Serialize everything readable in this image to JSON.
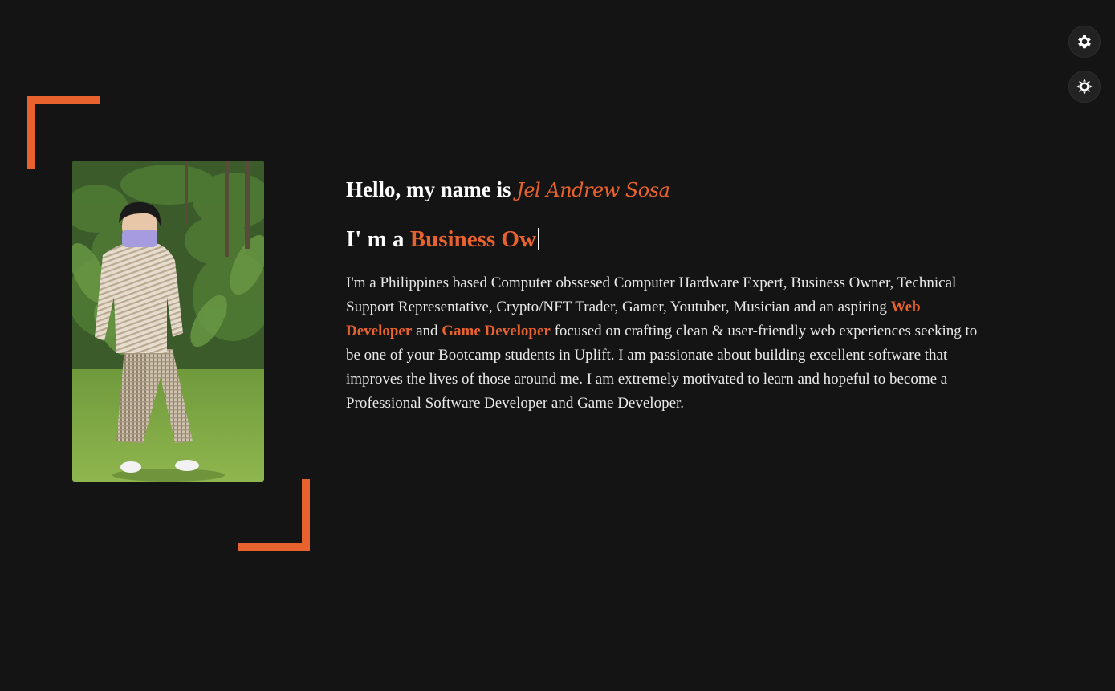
{
  "colors": {
    "background": "#141414",
    "accent": "#e8622d",
    "text": "#ffffff"
  },
  "controls": {
    "settings_icon": "gear-icon",
    "theme_icon": "sun-icon"
  },
  "profile": {
    "photo_icon": "profile-photo"
  },
  "intro": {
    "greeting_prefix": "Hello, my name is ",
    "name": "Jel Andrew Sosa",
    "role_prefix": "I' m a ",
    "role_typed": "Business Ow",
    "bio_part1": "I'm a Philippines based Computer obssesed Computer Hardware Expert, Business Owner, Technical Support Representative, Crypto/NFT Trader, Gamer, Youtuber, Musician and an aspiring ",
    "bio_hl1": "Web Developer",
    "bio_and": " and ",
    "bio_hl2": "Game Developer",
    "bio_part2": " focused on crafting clean & user-friendly web experiences seeking to be one of your Bootcamp students in Uplift. I am passionate about building excellent software that improves the lives of those around me. I am extremely motivated to learn and hopeful to become a Professional Software Developer and Game Developer."
  }
}
